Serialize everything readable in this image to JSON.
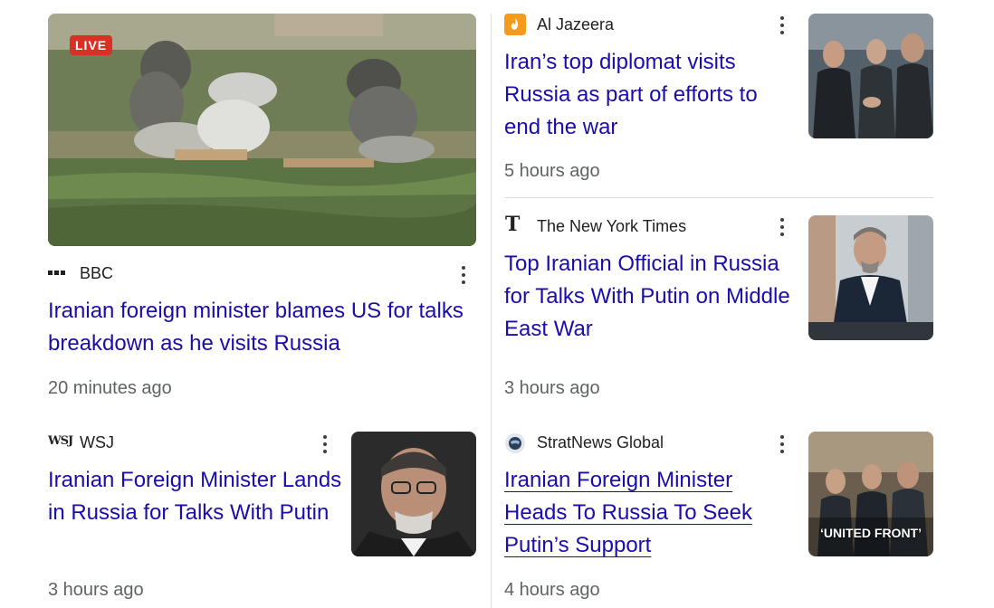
{
  "featured": {
    "live_badge": "LIVE",
    "source": "BBC",
    "headline": "Iranian foreign minister blames US for talks breakdown as he visits Russia",
    "time": "20 minutes ago"
  },
  "wsj": {
    "source": "WSJ",
    "source_logo": "WSJ",
    "headline": "Iranian Foreign Minister Lands in Russia for Talks With Putin",
    "time": "3 hours ago"
  },
  "aljazeera": {
    "source": "Al Jazeera",
    "headline": "Iran’s top diplomat visits Russia as part of efforts to end the war",
    "time": "5 hours ago"
  },
  "nyt": {
    "source": "The New York Times",
    "source_logo": "T",
    "headline": "Top Iranian Official in Russia for Talks With Putin on Middle East War",
    "time": "3 hours ago"
  },
  "stratnews": {
    "source": "StratNews Global",
    "headline": "Iranian Foreign Minister Heads To Russia To Seek Putin’s Support",
    "time": "4 hours ago",
    "image_caption": "‘UNITED FRONT’"
  },
  "colors": {
    "headline": "#1a0dab",
    "time": "#5f6368",
    "live": "#d93025",
    "aljazeera_brand": "#f59a1b"
  }
}
